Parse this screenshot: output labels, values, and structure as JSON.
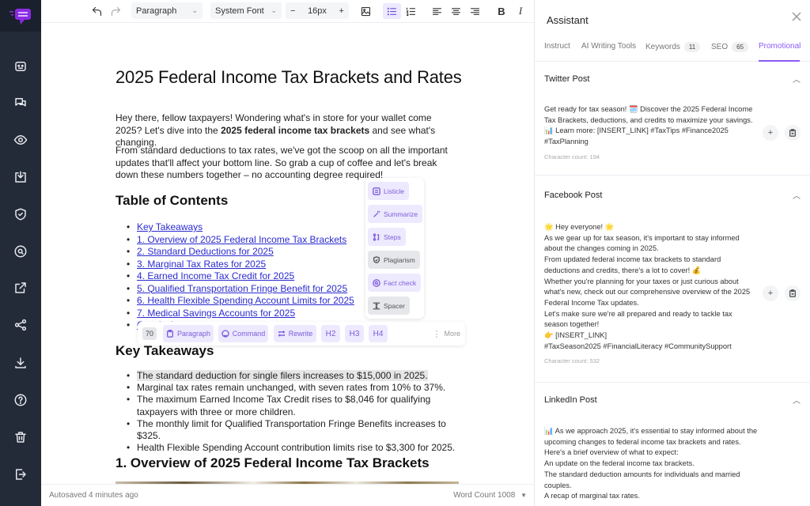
{
  "toolbar": {
    "block_type": "Paragraph",
    "font_family": "System Font",
    "font_size": "16px",
    "decrease": "−",
    "increase": "+"
  },
  "document": {
    "title": "2025 Federal Income Tax Brackets and Rates",
    "intro_p1_a": "Hey there, fellow taxpayers! Wondering what's in store for your wallet come 2025? Let's dive into the ",
    "intro_p1_bold": "2025 federal income tax brackets",
    "intro_p1_b": " and see what's changing.",
    "intro_p2": "From standard deductions to tax rates, we've got the scoop on all the important updates that'll affect your bottom line. So grab a cup of coffee and let's break down these numbers together – no accounting degree required!",
    "toc_heading": "Table of Contents",
    "toc": [
      "Key Takeaways",
      "1. Overview of 2025 Federal Income Tax Brackets",
      "2. Standard Deductions for 2025",
      "3. Marginal Tax Rates for 2025",
      "4. Earned Income Tax Credit for 2025",
      "5. Qualified Transportation Fringe Benefit for 2025",
      "6. Health Flexible Spending Account Limits for 2025",
      "7. Medical Savings Accounts for 2025",
      "Conclusion"
    ],
    "takeaways_heading": "Key Takeaways",
    "takeaways": [
      "The standard deduction for single filers increases to $15,000 in 2025.",
      "Marginal tax rates remain unchanged, with seven rates from 10% to 37%.",
      "The maximum Earned Income Tax Credit rises to $8,046 for qualifying taxpayers with three or more children.",
      "The monthly limit for Qualified Transportation Fringe Benefits increases to $325.",
      "Health Flexible Spending Account contribution limits rise to $3,300 for 2025."
    ],
    "overview_heading": "1. Overview of 2025 Federal Income Tax Brackets"
  },
  "ai_tools": [
    "Listicle",
    "Summarize",
    "Steps",
    "Plagiarism",
    "Fact check",
    "Spacer"
  ],
  "floating_bar": {
    "count": "70",
    "paragraph": "Paragraph",
    "command": "Command",
    "rewrite": "Rewrite",
    "h2": "H2",
    "h3": "H3",
    "h4": "H4",
    "more": "More"
  },
  "status": {
    "autosaved": "Autosaved 4 minutes ago",
    "word_count": "Word Count 1008"
  },
  "assistant": {
    "title": "Assistant",
    "tabs": [
      {
        "label": "Instruct"
      },
      {
        "label": "AI Writing Tools"
      },
      {
        "label": "Keywords",
        "badge": "11"
      },
      {
        "label": "SEO",
        "badge": "65"
      },
      {
        "label": "Promotional",
        "active": true
      }
    ],
    "sections": [
      {
        "title": "Twitter Post",
        "body": "Get ready for tax season! 🗓️ Discover the 2025 Federal Income Tax Brackets, deductions, and credits to maximize your savings. 📊 Learn more: [INSERT_LINK] #TaxTips #Finance2025 #TaxPlanning",
        "count": "Character count: 194"
      },
      {
        "title": "Facebook Post",
        "body": "🌟 Hey everyone! 🌟\nAs we gear up for tax season, it's important to stay informed about the changes coming in 2025.\nFrom updated federal income tax brackets to standard deductions and credits, there's a lot to cover! 💰\nWhether you're planning for your taxes or just curious about what's new, check out our comprehensive overview of the 2025 Federal Income Tax updates.\nLet's make sure we're all prepared and ready to tackle tax season together!\n👉 [INSERT_LINK]\n#TaxSeason2025 #FinancialLiteracy #CommunitySupport",
        "count": "Character count: 532"
      },
      {
        "title": "LinkedIn Post",
        "body": "📊 As we approach 2025, it's essential to stay informed about the upcoming changes to federal income tax brackets and rates.\nHere's a brief overview of what to expect:\nAn update on the federal income tax brackets.\nThe standard deduction amounts for individuals and married couples.\nA recap of marginal tax rates."
      }
    ]
  },
  "colors": {
    "accent": "#8b5cf6",
    "sidebar": "#232a38",
    "link": "#2a2ad0"
  }
}
